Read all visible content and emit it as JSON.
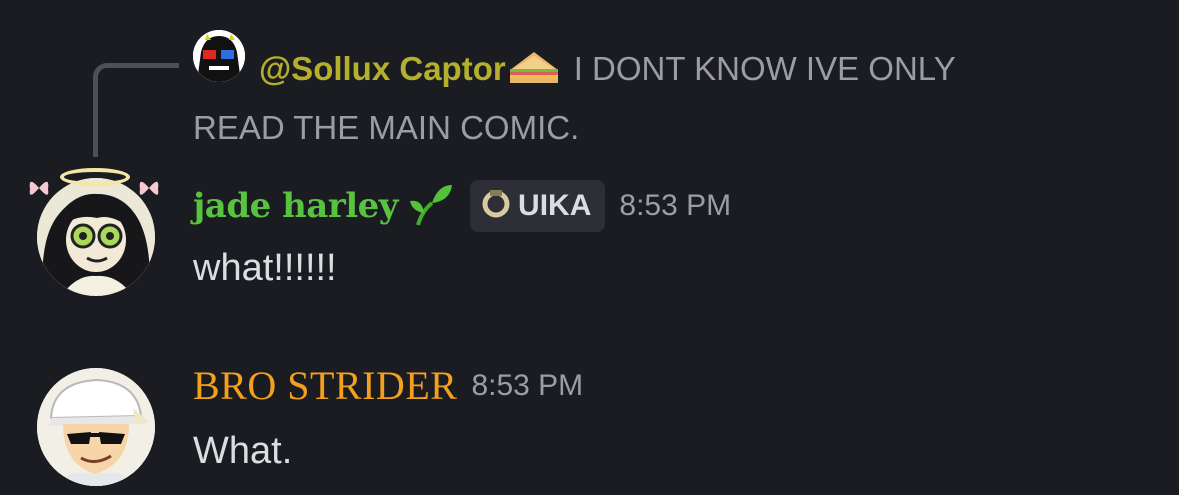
{
  "reply": {
    "author": "@Sollux Captor",
    "author_emoji": "sandwich-icon",
    "text_line1": "I DONT KNOW IVE ONLY",
    "text_line2": "READ THE MAIN COMIC."
  },
  "messages": [
    {
      "author": "jade harley",
      "author_icon": "sprout-icon",
      "badge": "UIKA",
      "badge_icon": "ring-icon",
      "timestamp": "8:53 PM",
      "text": "what!!!!!!",
      "name_color": "#58c33f"
    },
    {
      "author": "BRO STRIDER",
      "timestamp": "8:53 PM",
      "text": "What.",
      "name_color": "#f3a01d"
    }
  ],
  "colors": {
    "background": "#1b1c21",
    "reply_author": "#b5b02c",
    "muted_text": "#9c9ca6",
    "badge_bg": "#2e2f36"
  }
}
